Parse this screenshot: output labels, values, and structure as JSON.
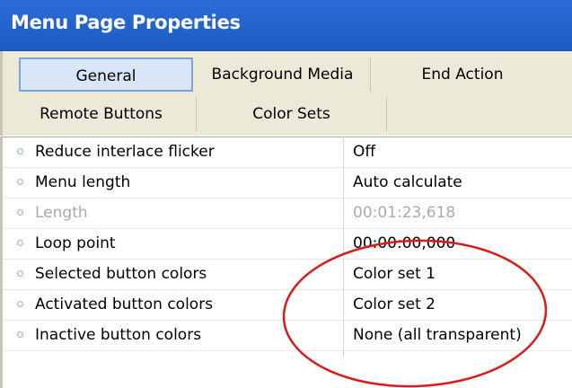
{
  "window": {
    "title": "Menu Page Properties"
  },
  "tabs": {
    "row1": [
      "General",
      "Background Media",
      "End Action"
    ],
    "row2": [
      "Remote Buttons",
      "Color Sets"
    ],
    "active": "General"
  },
  "properties": [
    {
      "name": "Reduce interlace flicker",
      "value": "Off",
      "disabled": false
    },
    {
      "name": "Menu length",
      "value": "Auto calculate",
      "disabled": false
    },
    {
      "name": "Length",
      "value": "00:01:23,618",
      "disabled": true
    },
    {
      "name": "Loop point",
      "value": "00:00:00,000",
      "disabled": false
    },
    {
      "name": "Selected button colors",
      "value": "Color set 1",
      "disabled": false
    },
    {
      "name": "Activated button colors",
      "value": "Color set 2",
      "disabled": false
    },
    {
      "name": "Inactive button colors",
      "value": "None (all transparent)",
      "disabled": false
    }
  ],
  "colors": {
    "title_bar": "#1e5bc3",
    "annotation_circle": "#d81c1c",
    "active_tab": "#d8e6f7"
  }
}
